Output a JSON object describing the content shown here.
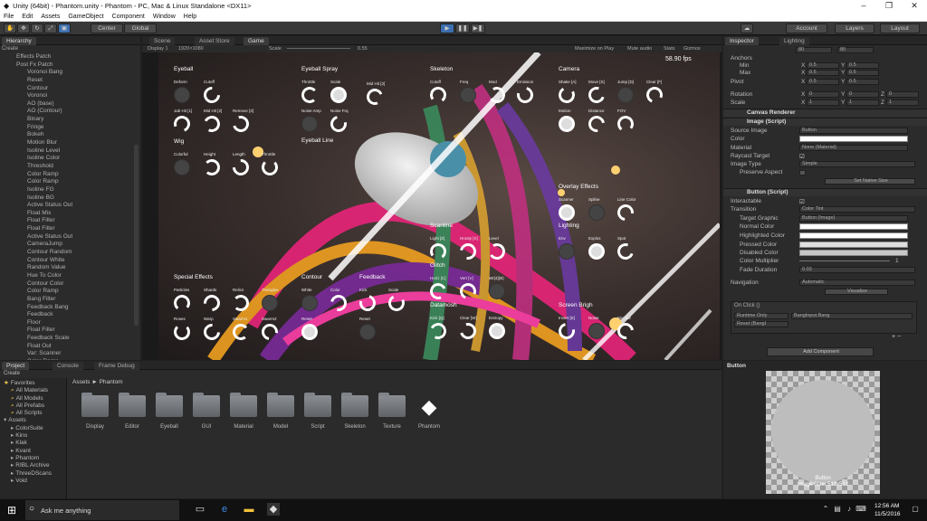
{
  "window": {
    "title": "Unity (64bit) - Phantom.unity - Phantom - PC, Mac & Linux Standalone <DX11>",
    "minimize": "–",
    "maximize": "❐",
    "close": "✕"
  },
  "menu": [
    "File",
    "Edit",
    "Assets",
    "GameObject",
    "Component",
    "Window",
    "Help"
  ],
  "toolbar": {
    "pivot": "Center",
    "space": "Global",
    "play": "▶",
    "pause": "❚❚",
    "step": "▶❚",
    "account": "Account",
    "layers": "Layers",
    "layout": "Layout"
  },
  "hierarchy": {
    "tab": "Hierarchy",
    "create": "Create",
    "items": [
      {
        "t": "Effects Patch",
        "root": true
      },
      {
        "t": "Post Fx Patch",
        "root": true
      },
      "Voronoi Bang",
      "Reset",
      "Contour",
      "Voronoi",
      "AO (base)",
      "AO (Contour)",
      "Binary",
      "Fringe",
      "Bokeh",
      "Motion Blur",
      "Isoline Level",
      "Isoline Color",
      "Threshold",
      "Color Ramp",
      "Color Ramp",
      "Isoline FG",
      "Isoline BG",
      "Active Status Out",
      "Float Mix",
      "Float Filter",
      "Float Filter",
      "Active Status Out",
      "CameraJump",
      "Contour Random",
      "Contour White",
      "Random Value",
      "Hue To Color",
      "Contour Color",
      "Color Ramp",
      "Bang Filter",
      "Feedback Bang",
      "Feedback",
      "Floor",
      "Float Filter",
      "Feedback Scale",
      "Float Out",
      "Var: Scanner",
      "Color Ramp"
    ]
  },
  "view_tabs": {
    "scene": "Scene",
    "asset_store": "Asset Store",
    "game": "Game"
  },
  "game_bar": {
    "display": "Display 1",
    "resolution": "1920×1080",
    "scale_label": "Scale",
    "scale_value": "0.55",
    "maximize": "Maximize on Play",
    "mute": "Mute audio",
    "stats": "Stats",
    "gizmos": "Gizmos"
  },
  "fps": "58.90 fps",
  "sections": [
    {
      "id": "eyeball",
      "title": "Eyeball"
    },
    {
      "id": "eyeball_spray",
      "title": "Eyeball Spray"
    },
    {
      "id": "skeleton",
      "title": "Skeleton"
    },
    {
      "id": "camera",
      "title": "Camera"
    },
    {
      "id": "wig",
      "title": "Wig"
    },
    {
      "id": "eyeball_line",
      "title": "Eyeball Line"
    },
    {
      "id": "overlay",
      "title": "Overlay Effects"
    },
    {
      "id": "lighting",
      "title": "Lighting"
    },
    {
      "id": "scanline",
      "title": "Scanline"
    },
    {
      "id": "glitch",
      "title": "Glitch"
    },
    {
      "id": "datamosh",
      "title": "Datamosh"
    },
    {
      "id": "screen_bright",
      "title": "Screen Brigh"
    },
    {
      "id": "special",
      "title": "Special Effects"
    },
    {
      "id": "contour",
      "title": "Contour"
    },
    {
      "id": "feedback",
      "title": "Feedback"
    }
  ],
  "knob_labels": [
    "Deform",
    "Cutoff",
    "Throttle",
    "Scale",
    "Cutoff",
    "Freq",
    "Mod",
    "Emission",
    "Shake [A]",
    "Move [S]",
    "Jump [D]",
    "Clear [F]",
    "Jab Hit [1]",
    "Mid Hit [2]",
    "Remove [3]",
    "Noise Amp",
    "Noise Frq",
    "Motion",
    "Distance",
    "FOV",
    "Colorful",
    "Height",
    "Length",
    "Throttle",
    "Scanner",
    "Spline",
    "Line Color",
    "Light [Z]",
    "Hrosty [X]",
    "Level",
    "Env",
    "Explos",
    "Spot",
    "Horiz [C]",
    "Vert [V]",
    "Wr[4](B)",
    "Kick [Q]",
    "Clear [W]",
    "Entropy",
    "Invert [E]",
    "Noise",
    "Monitor",
    "Particles",
    "Shards",
    "Relics",
    "Triangles",
    "Roses",
    "Warp",
    "Swarm1",
    "Swarm2",
    "White",
    "Color",
    "Reset",
    "Kick",
    "Scale",
    "Reset",
    "Mid Hit [2]"
  ],
  "inspector": {
    "tab": "Inspector",
    "tab2": "Lighting",
    "top_vals": [
      "80",
      "80"
    ],
    "anchors": "Anchors",
    "min": "Min",
    "max": "Max",
    "pivot": "Pivot",
    "x": "X",
    "y": "Y",
    "z": "Z",
    "min_x": "0.5",
    "min_y": "0.5",
    "max_x": "0.5",
    "max_y": "0.5",
    "pivot_x": "0.5",
    "pivot_y": "0.5",
    "rotation": "Rotation",
    "rot_x": "0",
    "rot_y": "0",
    "rot_z": "0",
    "scale": "Scale",
    "sc_x": "1",
    "sc_y": "1",
    "sc_z": "1",
    "canvas_renderer": "Canvas Renderer",
    "image_script": "Image (Script)",
    "source_image": "Source Image",
    "source_image_val": "Button",
    "color": "Color",
    "material": "Material",
    "material_val": "None (Material)",
    "raycast": "Raycast Target",
    "image_type": "Image Type",
    "image_type_val": "Simple",
    "preserve": "Preserve Aspect",
    "native": "Set Native Size",
    "button_script": "Button (Script)",
    "interactable": "Interactable",
    "transition": "Transition",
    "transition_val": "Color Tint",
    "target_graphic": "Target Graphic",
    "target_graphic_val": "Button (Image)",
    "normal": "Normal Color",
    "highlighted": "Highlighted Color",
    "pressed": "Pressed Color",
    "disabled": "Disabled Color",
    "multiplier": "Color Multiplier",
    "multiplier_val": "1",
    "fade": "Fade Duration",
    "fade_val": "0.03",
    "navigation": "Navigation",
    "navigation_val": "Automatic",
    "visualize": "Visualize",
    "onclick": "On Click ()",
    "runtime": "Runtime Only",
    "bang": "BangInput.Bang",
    "reset": "Reset (BangI",
    "add_component": "Add Component",
    "preview_title": "Button",
    "preview_name": "Button",
    "preview_size": "Image Size: 512x512"
  },
  "project": {
    "tab": "Project",
    "console": "Console",
    "frame_debug": "Frame Debug",
    "create": "Create",
    "favorites": "Favorites",
    "fav_items": [
      "All Materials",
      "All Models",
      "All Prefabs",
      "All Scripts"
    ],
    "assets": "Assets",
    "asset_items": [
      "ColorSuite",
      "Kino",
      "Klak",
      "Kvant",
      "Phantom",
      "RIBL Archive",
      "ThreeDScans",
      "Void"
    ],
    "breadcrumb_assets": "Assets",
    "breadcrumb_sep": "►",
    "breadcrumb_phantom": "Phantom",
    "folders": [
      "Display",
      "Editor",
      "Eyeball",
      "GUI",
      "Material",
      "Model",
      "Script",
      "Skeleton",
      "Texture",
      "Phantom"
    ]
  },
  "taskbar": {
    "search": "Ask me anything",
    "time": "12:56 AM",
    "date": "11/5/2016"
  }
}
